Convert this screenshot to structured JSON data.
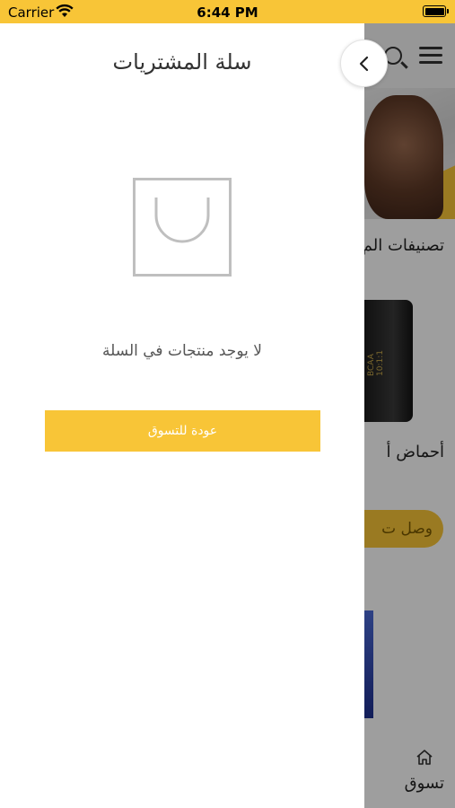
{
  "status_bar": {
    "carrier": "Carrier",
    "time": "6:44 PM"
  },
  "drawer": {
    "title": "سلة المشتريات",
    "empty_message": "لا يوجد منتجات في السلة",
    "continue_shopping": "عودة للتسوق"
  },
  "background": {
    "section_title": "تصنيفات الم",
    "product_name": "أحماض أ",
    "product_label": "HIT BCAA 10:1:1",
    "cta": "وصل ت",
    "nav_home_label": "تسوق"
  },
  "colors": {
    "accent": "#f8c537",
    "text": "#333333",
    "muted": "#555555"
  },
  "icons": {
    "back": "chevron-left-icon",
    "bag": "shopping-bag-icon",
    "search": "search-icon",
    "menu": "hamburger-menu-icon",
    "home": "home-icon",
    "wifi": "wifi-icon",
    "battery": "battery-icon"
  }
}
